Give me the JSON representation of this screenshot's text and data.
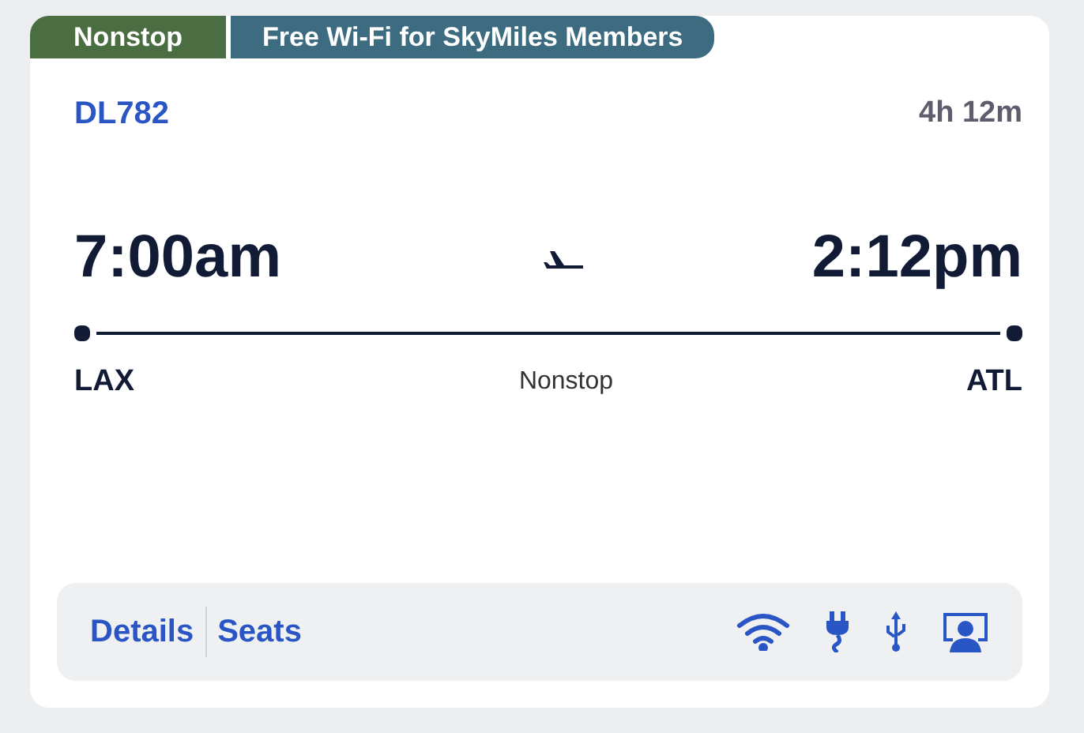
{
  "tags": [
    {
      "label": "Nonstop",
      "color": "#4a6d41"
    },
    {
      "label": "Free Wi-Fi for SkyMiles Members",
      "color": "#3d6b80"
    }
  ],
  "flight": {
    "number": "DL782",
    "duration": "4h 12m",
    "departure_time": "7:00am",
    "arrival_time": "2:12pm",
    "origin": "LAX",
    "destination": "ATL",
    "stops": "Nonstop"
  },
  "links": [
    "Details",
    "Seats"
  ]
}
